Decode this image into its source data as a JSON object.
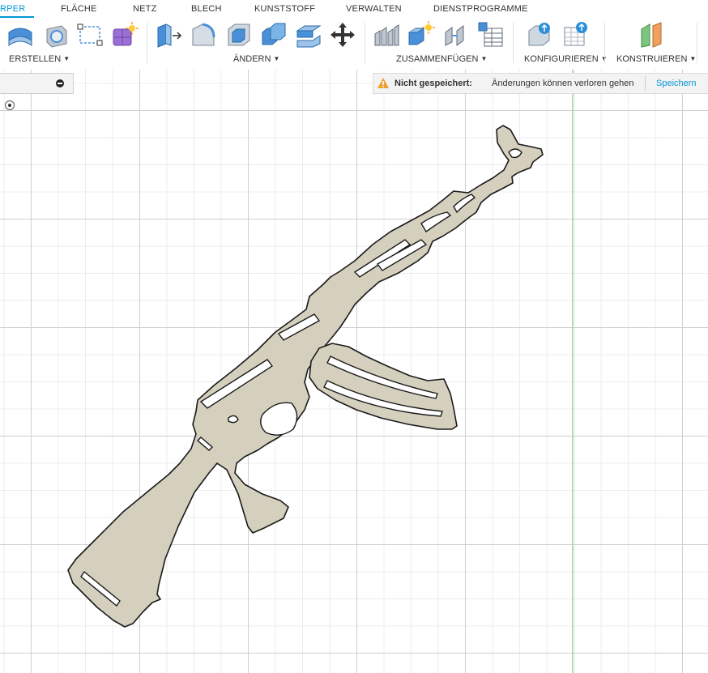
{
  "tabs": [
    "RPER",
    "FLÄCHE",
    "NETZ",
    "BLECH",
    "KUNSTSTOFF",
    "VERWALTEN",
    "DIENSTPROGRAMME"
  ],
  "active_tab": "RPER",
  "groups": {
    "erstellen": "ERSTELLEN",
    "aendern": "ÄNDERN",
    "zusammenfuegen": "ZUSAMMENFÜGEN",
    "konfigurieren": "KONFIGURIEREN",
    "konstruieren": "KONSTRUIEREN"
  },
  "toolbar_icons": {
    "erstellen": [
      "extrude-icon",
      "hole-icon",
      "sketch-icon",
      "form-icon"
    ],
    "aendern": [
      "press-pull-icon",
      "fillet-icon",
      "shell-icon",
      "combine-icon",
      "offset-face-icon",
      "move-icon"
    ],
    "zusammenfuegen": [
      "new-component-icon",
      "joint-icon",
      "as-built-joint-icon",
      "table-icon"
    ],
    "konfigurieren": [
      "configure-icon",
      "configure-table-icon"
    ],
    "konstruieren": [
      "plane-icon"
    ]
  },
  "notice": {
    "title": "Nicht gespeichert:",
    "message": "Änderungen können verloren gehen",
    "save_label": "Speichern"
  },
  "colors": {
    "accent": "#0696d7",
    "warning": "#f0a030",
    "body_fill": "#d5cfbd",
    "outline": "#1a1a1a",
    "axis_green": "#7fe07f"
  }
}
